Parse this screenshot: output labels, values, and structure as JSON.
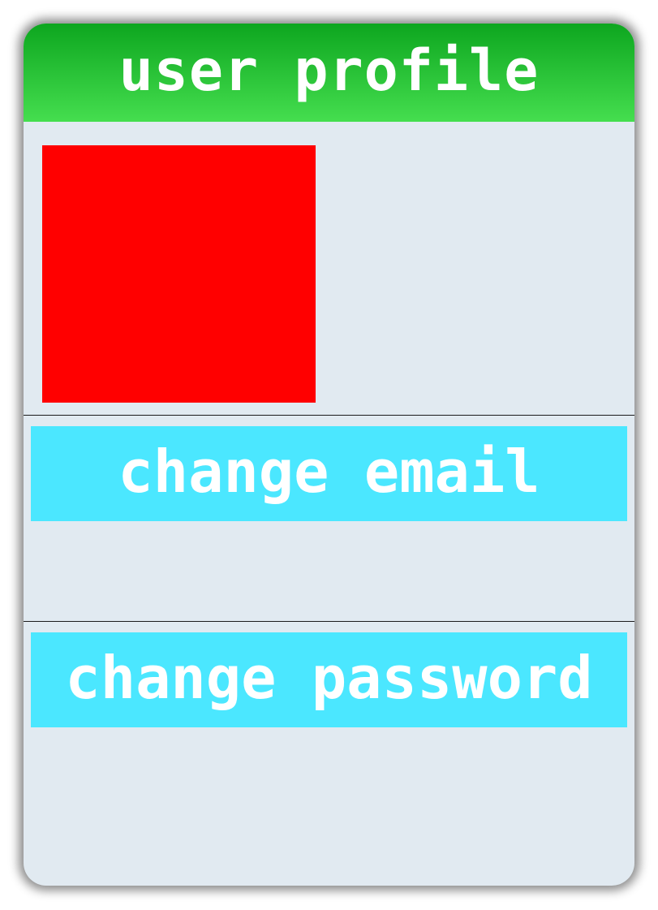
{
  "header": {
    "title": "user profile"
  },
  "profile": {
    "avatar_color": "#ff0000"
  },
  "actions": {
    "change_email_label": "change email",
    "change_password_label": "change password"
  },
  "colors": {
    "header_top": "#0da61f",
    "header_bottom": "#45de4f",
    "card_background": "#e1eaf1",
    "button_background": "#4be7ff",
    "button_text": "#ffffff"
  }
}
